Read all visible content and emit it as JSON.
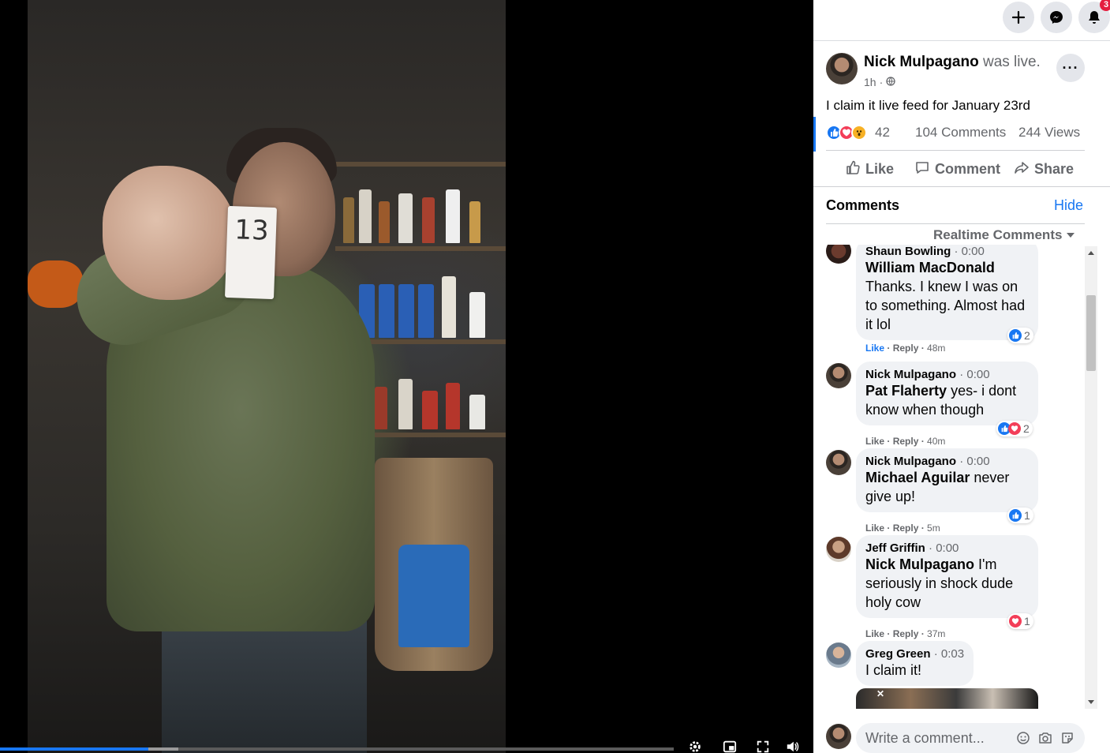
{
  "video": {
    "card_number": "13",
    "progress_fraction": 0.22,
    "buffered_fraction": 0.265,
    "controls": [
      {
        "name": "settings-icon"
      },
      {
        "name": "picture-in-picture-icon"
      },
      {
        "name": "fullscreen-icon"
      },
      {
        "name": "volume-icon"
      }
    ]
  },
  "topbar": {
    "buttons": [
      "plus-icon",
      "messenger-icon",
      "bell-icon"
    ],
    "notification_count": "3"
  },
  "post": {
    "author": "Nick Mulpagano",
    "status": "was live.",
    "time": "1h",
    "privacy_separator": "·",
    "more_label": "···",
    "text": "I claim it live feed for January 23rd",
    "reaction_count": "42",
    "comments_label": "104 Comments",
    "views_label": "244 Views",
    "actions": {
      "like": "Like",
      "comment": "Comment",
      "share": "Share"
    }
  },
  "comments_section": {
    "heading": "Comments",
    "hide_label": "Hide",
    "sort_label": "Realtime Comments"
  },
  "comments": [
    {
      "author": "Shaun Bowling",
      "timestamp": "0:00",
      "mention": "William MacDonald",
      "body": "Thanks. I knew I was on to something. Almost had it lol",
      "like": "Like",
      "reply": "Reply",
      "age": "48m",
      "reaction_count": "2",
      "liked": true
    },
    {
      "author": "Nick Mulpagano",
      "timestamp": "0:00",
      "mention": "Pat Flaherty",
      "body": "yes- i dont know when though",
      "like": "Like",
      "reply": "Reply",
      "age": "40m",
      "reaction_count": "2"
    },
    {
      "author": "Nick Mulpagano",
      "timestamp": "0:00",
      "mention": "Michael Aguilar",
      "body": "never give up!",
      "like": "Like",
      "reply": "Reply",
      "age": "5m",
      "reaction_count": "1"
    },
    {
      "author": "Jeff Griffin",
      "timestamp": "0:00",
      "mention": "Nick Mulpagano",
      "body": "I'm seriously in shock dude holy cow",
      "like": "Like",
      "reply": "Reply",
      "age": "37m",
      "reaction_count": "1"
    },
    {
      "author": "Greg Green",
      "timestamp": "0:03",
      "body": "I claim it!"
    }
  ],
  "composer": {
    "placeholder": "Write a comment..."
  },
  "colors": {
    "accent": "#1877f2",
    "love": "#f33e58",
    "wow": "#f7b125",
    "notification": "#e41e3f"
  }
}
